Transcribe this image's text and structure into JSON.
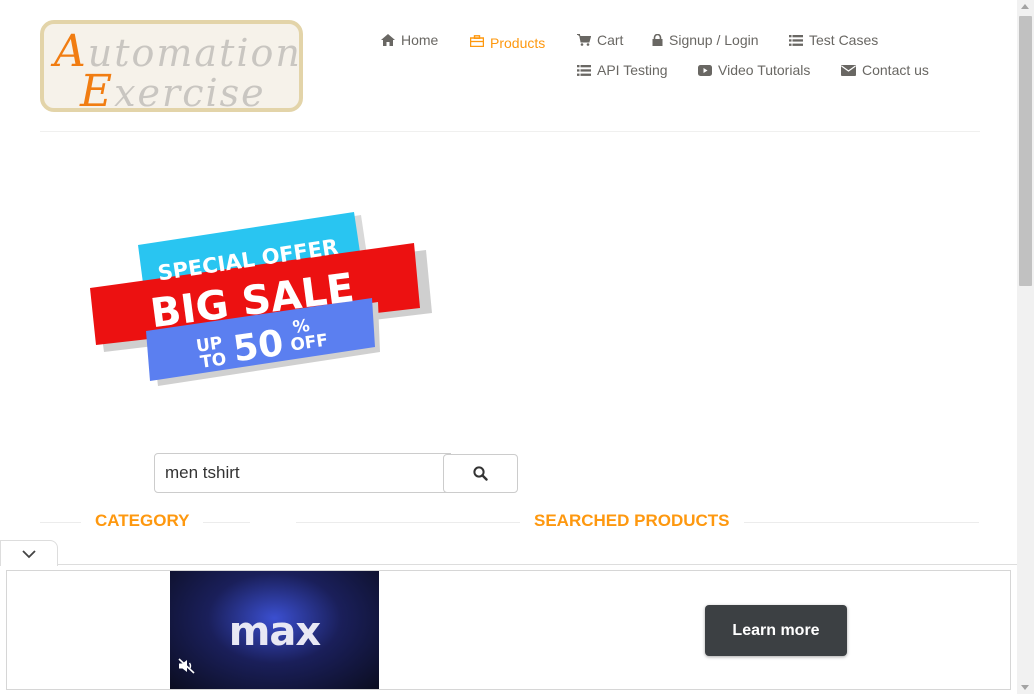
{
  "logo": {
    "line1_cap": "A",
    "line1_rest": "utomation",
    "line2_cap": "E",
    "line2_rest": "xercise"
  },
  "nav": [
    {
      "label": "Home",
      "icon": "home-icon",
      "active": false
    },
    {
      "label": "Products",
      "icon": "products-icon",
      "active": true
    },
    {
      "label": "Cart",
      "icon": "cart-icon",
      "active": false
    },
    {
      "label": "Signup / Login",
      "icon": "lock-icon",
      "active": false
    },
    {
      "label": "Test Cases",
      "icon": "list-icon",
      "active": false
    },
    {
      "label": "API Testing",
      "icon": "list-icon",
      "active": false
    },
    {
      "label": "Video Tutorials",
      "icon": "youtube-icon",
      "active": false
    },
    {
      "label": "Contact us",
      "icon": "envelope-icon",
      "active": false
    }
  ],
  "banner": {
    "line1": "SPECIAL OFFER",
    "line2": "BIG SALE",
    "up": "UP",
    "to": "TO",
    "amount": "50",
    "percent": "%",
    "off": "OFF"
  },
  "search": {
    "value": "men tshirt"
  },
  "sections": {
    "category": "CATEGORY",
    "searched": "SEARCHED PRODUCTS"
  },
  "ad": {
    "brand": "max",
    "cta": "Learn more"
  },
  "colors": {
    "accent": "#fe980f",
    "text": "#696763",
    "logo_orange": "#f17d12",
    "button_dark": "#3c4043"
  }
}
